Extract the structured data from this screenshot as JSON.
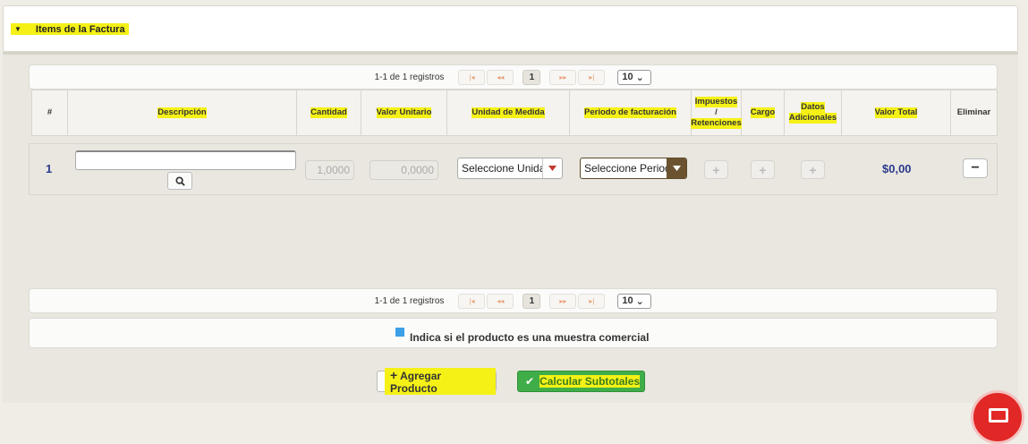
{
  "section": {
    "title": "Items de la Factura"
  },
  "pager": {
    "info": "1-1 de 1 registros",
    "page": "1",
    "page_size": "10"
  },
  "columns": [
    {
      "key": "num",
      "label": "#"
    },
    {
      "key": "desc",
      "label": "Descripción"
    },
    {
      "key": "qty",
      "label": "Cantidad"
    },
    {
      "key": "unit_value",
      "label": "Valor Unitario"
    },
    {
      "key": "uom",
      "label": "Unidad de Medida"
    },
    {
      "key": "period",
      "label": "Periodo de facturación"
    },
    {
      "key": "taxes",
      "label_1": "Impuestos",
      "label_2": "/",
      "label_3": "Retenciones"
    },
    {
      "key": "charge",
      "label": "Cargo"
    },
    {
      "key": "extra",
      "label_1": "Datos",
      "label_2": "Adicionales"
    },
    {
      "key": "total",
      "label": "Valor Total"
    },
    {
      "key": "delete",
      "label": "Eliminar"
    }
  ],
  "row": {
    "num": "1",
    "description": "",
    "quantity": "1,0000",
    "unit_value": "0,0000",
    "uom_select": "Seleccione Unidad",
    "period_select": "Seleccione Periodo",
    "total": "$0,00"
  },
  "legend": {
    "text": "Indica si el producto es una muestra comercial",
    "color": "#3ba0e6"
  },
  "buttons": {
    "add": "Agregar Producto",
    "calc": "Calcular Subtotales"
  },
  "colors": {
    "highlight": "#f5f116",
    "accent_green": "#3fae49",
    "fab_red": "#e12826",
    "number_blue": "#2c3a8c"
  },
  "icons": [
    "caret-down-icon",
    "first-page-icon",
    "prev-page-icon",
    "next-page-icon",
    "last-page-icon",
    "search-icon",
    "plus-icon",
    "minus-icon",
    "check-icon",
    "chat-icon"
  ]
}
